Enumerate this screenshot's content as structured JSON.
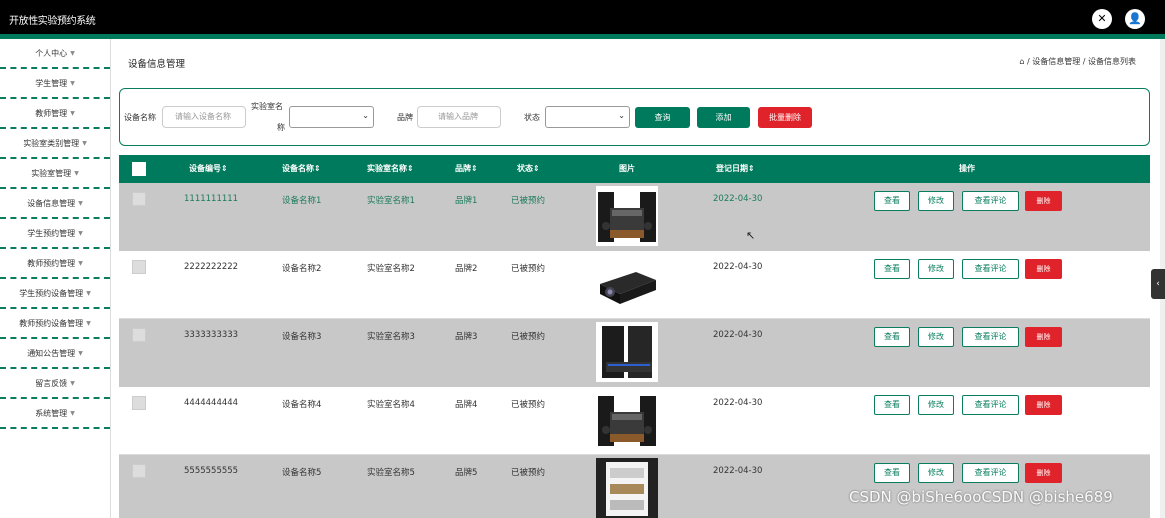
{
  "app": {
    "title": "开放性实验预约系统",
    "fullscreen_icon": "fullscreen-exit-icon",
    "user_icon": "user-icon"
  },
  "sidebar": {
    "items": [
      {
        "label": "个人中心"
      },
      {
        "label": "学生管理"
      },
      {
        "label": "教师管理"
      },
      {
        "label": "实验室类别管理"
      },
      {
        "label": "实验室管理"
      },
      {
        "label": "设备信息管理"
      },
      {
        "label": "学生预约管理"
      },
      {
        "label": "教师预约管理"
      },
      {
        "label": "学生预约设备管理"
      },
      {
        "label": "教师预约设备管理"
      },
      {
        "label": "通知公告管理"
      },
      {
        "label": "留言反馈"
      },
      {
        "label": "系统管理"
      }
    ]
  },
  "page": {
    "title": "设备信息管理",
    "breadcrumb": {
      "home_icon": "home-icon",
      "text": " / 设备信息管理 / 设备信息列表"
    }
  },
  "search": {
    "name_label": "设备名称",
    "name_placeholder": "请输入设备名称",
    "lab_label_1": "实验室名",
    "lab_label_2": "称",
    "brand_label": "品牌",
    "brand_placeholder": "请输入品牌",
    "status_label": "状态",
    "query": "查询",
    "add": "添加",
    "batch_delete": "批量删除"
  },
  "table": {
    "headers": [
      "设备编号⇕",
      "设备名称⇕",
      "实验室名称⇕",
      "品牌⇕",
      "状态⇕",
      "图片",
      "登记日期⇕",
      "操作"
    ],
    "rows": [
      {
        "id": "1111111111",
        "name": "设备名称1",
        "lab": "实验室名称1",
        "brand": "品牌1",
        "status": "已被预约",
        "date": "2022-04-30",
        "img": "mixer-speakers"
      },
      {
        "id": "2222222222",
        "name": "设备名称2",
        "lab": "实验室名称2",
        "brand": "品牌2",
        "status": "已被预约",
        "date": "2022-04-30",
        "img": "projector"
      },
      {
        "id": "3333333333",
        "name": "设备名称3",
        "lab": "实验室名称3",
        "brand": "品牌3",
        "status": "已被预约",
        "date": "2022-04-30",
        "img": "speakers"
      },
      {
        "id": "4444444444",
        "name": "设备名称4",
        "lab": "实验室名称4",
        "brand": "品牌4",
        "status": "已被预约",
        "date": "2022-04-30",
        "img": "mixer-speakers"
      },
      {
        "id": "5555555555",
        "name": "设备名称5",
        "lab": "实验室名称5",
        "brand": "品牌5",
        "status": "已被预约",
        "date": "2022-04-30",
        "img": "cabinet"
      }
    ],
    "actions": {
      "view": "查看",
      "edit": "修改",
      "comments": "查看评论",
      "delete": "删除"
    }
  },
  "watermark": "CSDN @biShe6ooCSDN @bishe689",
  "colors": {
    "primary": "#007a5c",
    "danger": "#e0232a",
    "header_bg": "#000000"
  }
}
